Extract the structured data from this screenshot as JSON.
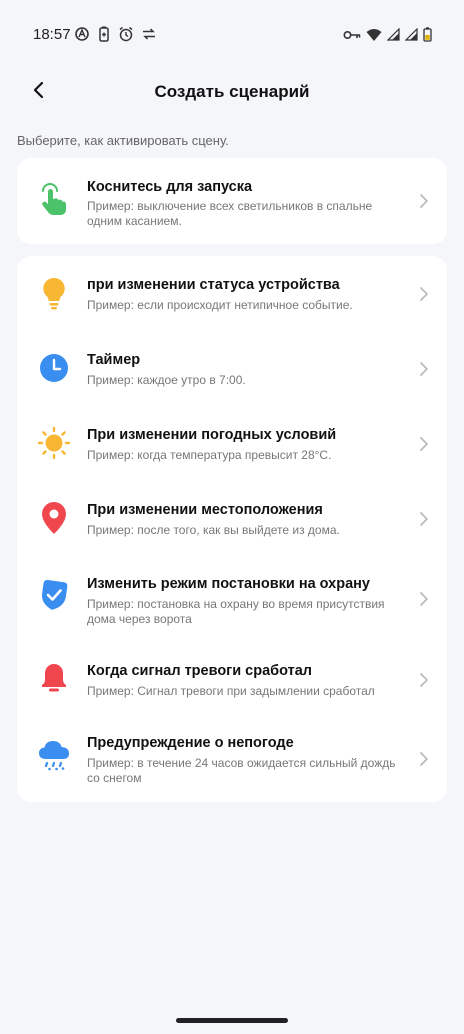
{
  "status_bar": {
    "time": "18:57",
    "left_icons": [
      "vpn-icon",
      "battery-saver-icon",
      "alarm-icon",
      "data-transfer-icon"
    ],
    "right_icons": [
      "key-icon",
      "wifi-icon",
      "signal-icon",
      "signal-icon",
      "battery-icon"
    ]
  },
  "header": {
    "title": "Создать сценарий",
    "back_icon": "chevron-left-icon"
  },
  "subtitle": "Выберите, как активировать сцену.",
  "manual": {
    "title": "Коснитесь для запуска",
    "desc": "Пример: выключение всех светильников в спальне одним касанием.",
    "icon": "tap-hand-icon",
    "color": "#4cc36b"
  },
  "triggers": [
    {
      "title": "при изменении статуса устройства",
      "desc": "Пример: если происходит нетипичное событие.",
      "icon": "bulb-icon",
      "color": "#f7b733"
    },
    {
      "title": "Таймер",
      "desc": "Пример: каждое утро в 7:00.",
      "icon": "clock-icon",
      "color": "#3a8ef0"
    },
    {
      "title": "При изменении погодных условий",
      "desc": "Пример: когда температура превысит 28°C.",
      "icon": "sun-icon",
      "color": "#f7b733"
    },
    {
      "title": "При изменении местоположения",
      "desc": "Пример: после того, как вы выйдете из дома.",
      "icon": "location-pin-icon",
      "color": "#f0474f"
    },
    {
      "title": "Изменить режим постановки на охрану",
      "desc": "Пример: постановка на охрану во время присутствия дома через ворота",
      "icon": "shield-check-icon",
      "color": "#3a8ef0"
    },
    {
      "title": "Когда сигнал тревоги сработал",
      "desc": "Пример: Сигнал тревоги при задымлении сработал",
      "icon": "alarm-bell-icon",
      "color": "#f0474f"
    },
    {
      "title": "Предупреждение о непогоде",
      "desc": "Пример: в течение 24 часов ожидается сильный дождь со снегом",
      "icon": "snow-cloud-icon",
      "color": "#3a8ef0"
    }
  ]
}
